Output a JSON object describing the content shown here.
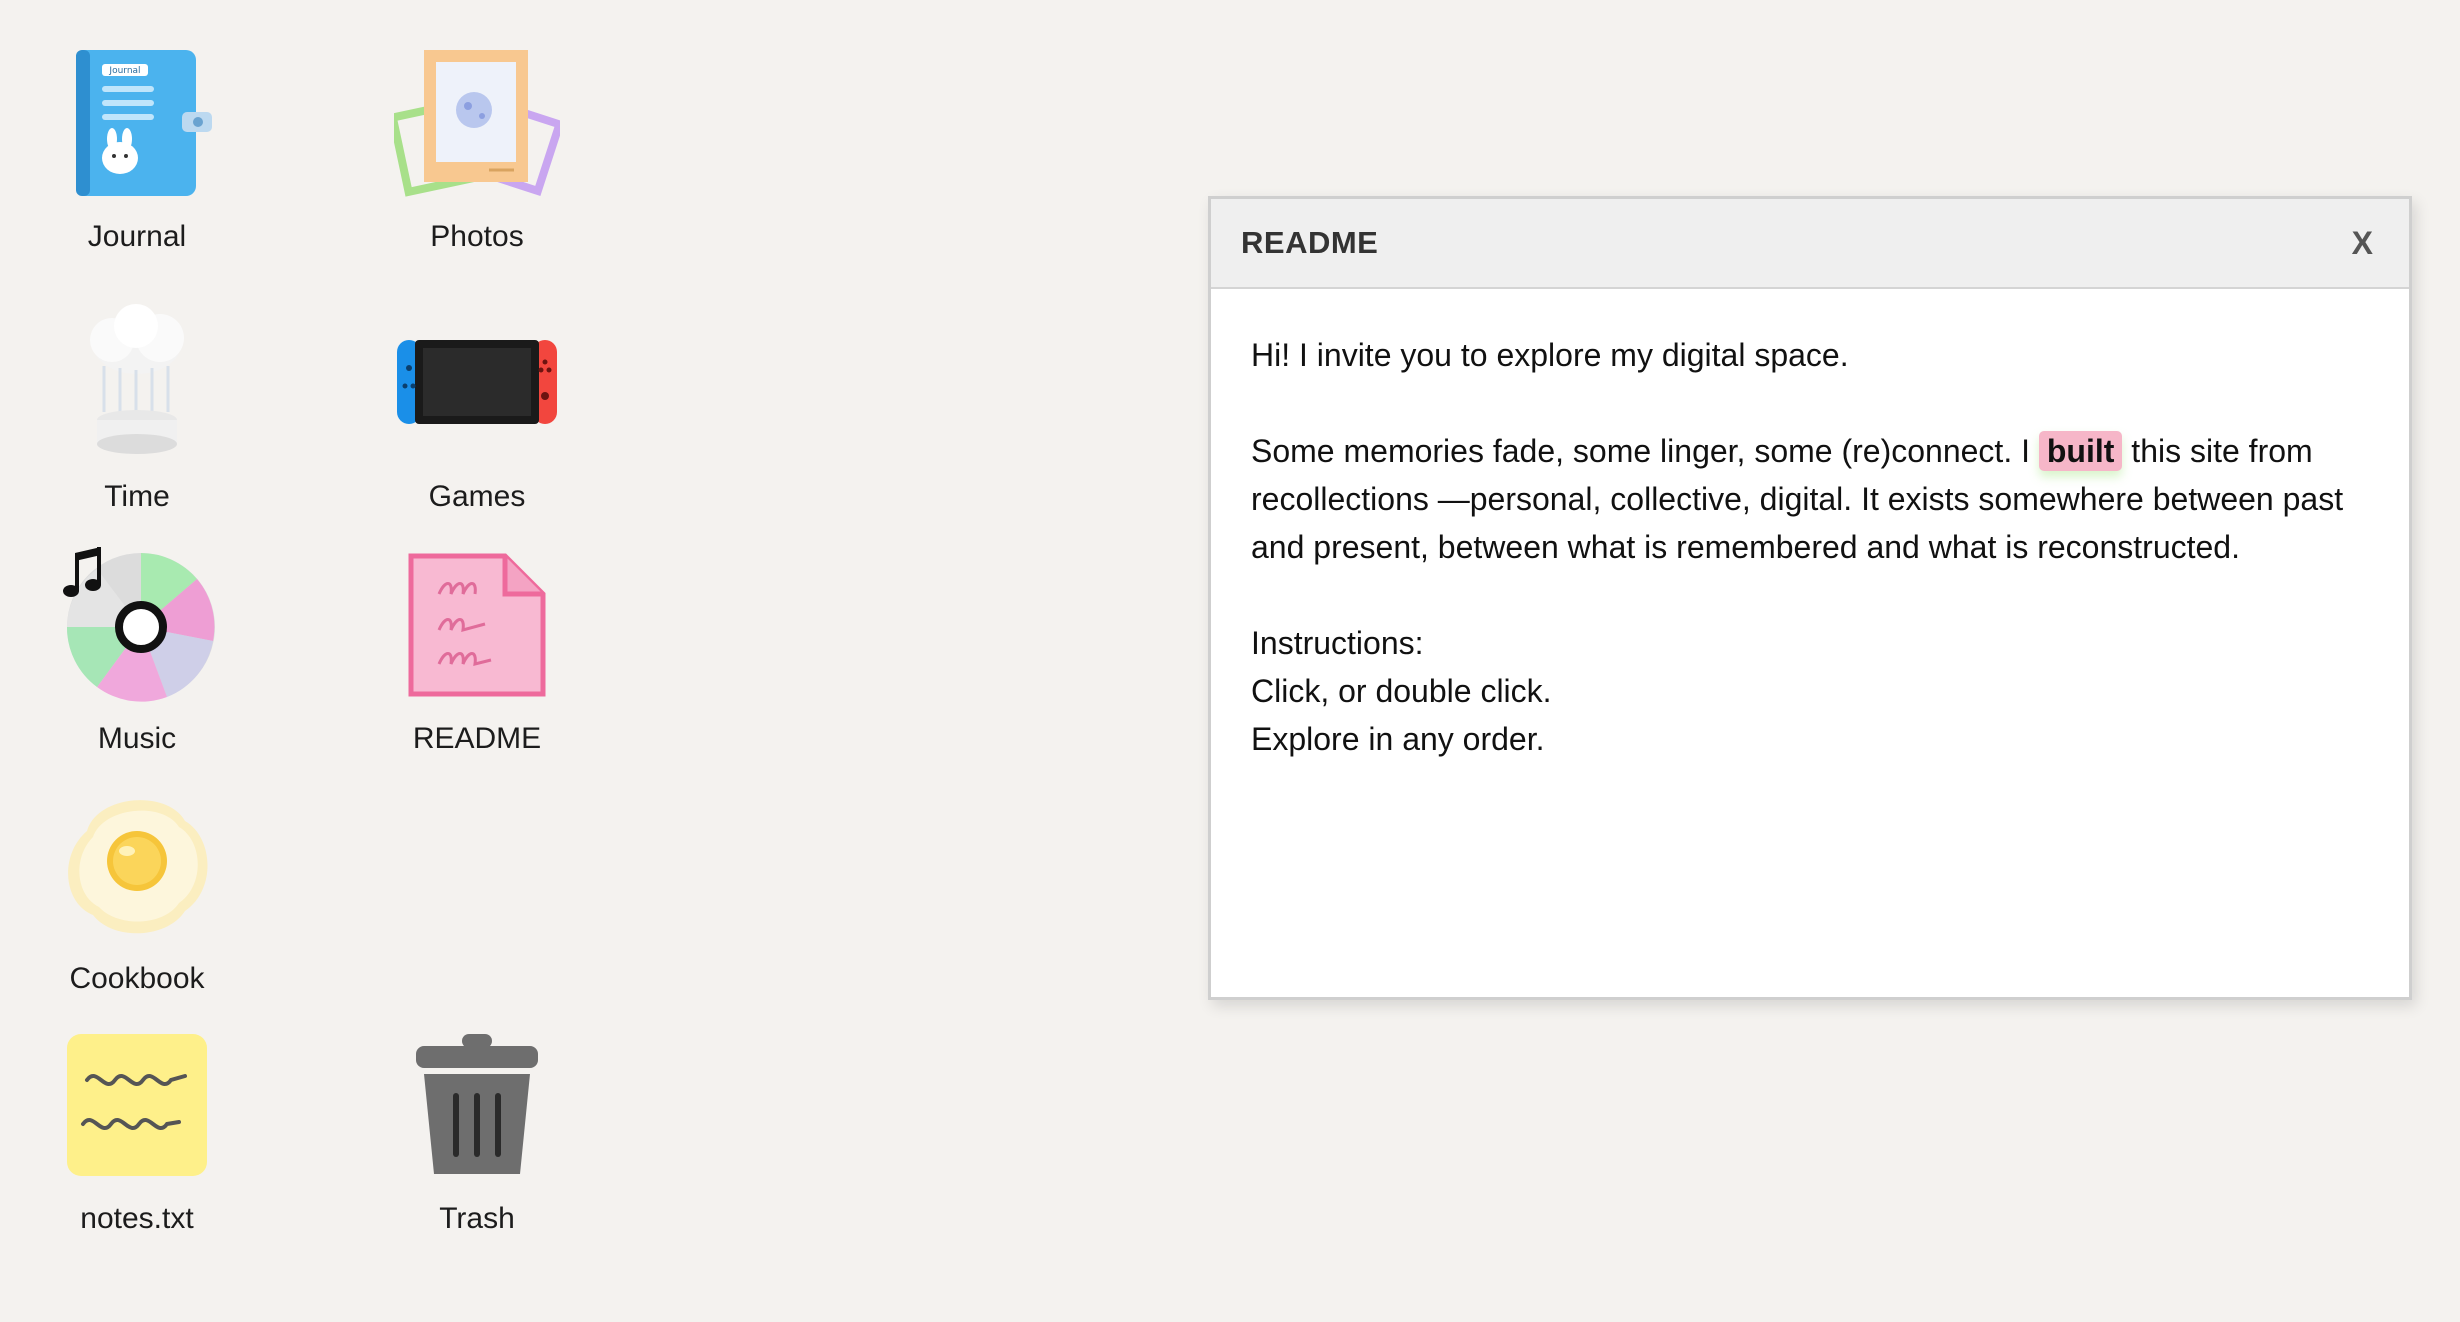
{
  "desktop": {
    "icons": [
      {
        "label": "Journal",
        "icon": "journal-icon",
        "text": "Journal"
      },
      {
        "label": "Photos",
        "icon": "photos-icon"
      },
      {
        "label": "Time",
        "icon": "time-icon"
      },
      {
        "label": "Games",
        "icon": "games-icon"
      },
      {
        "label": "Music",
        "icon": "music-icon"
      },
      {
        "label": "README",
        "icon": "readme-icon"
      },
      {
        "label": "Cookbook",
        "icon": "cookbook-icon"
      },
      {
        "label": "notes.txt",
        "icon": "notes-icon"
      },
      {
        "label": "Trash",
        "icon": "trash-icon"
      }
    ]
  },
  "readme_window": {
    "title": "README",
    "close_label": "X",
    "intro": "Hi! I invite you to explore my digital space.",
    "para_before": "Some memories fade, some linger, some (re)connect. I ",
    "highlight_word": "built",
    "para_after": " this site from recollections —personal, collective, digital. It exists somewhere between past and present, between what is remembered and what is reconstructed.",
    "instructions_heading": "Instructions:",
    "instructions": [
      "Click, or double click.",
      "Explore in any order."
    ]
  },
  "colors": {
    "background": "#f4f2ef",
    "highlight": "#f6b6c8",
    "titlebar": "#efefef"
  }
}
